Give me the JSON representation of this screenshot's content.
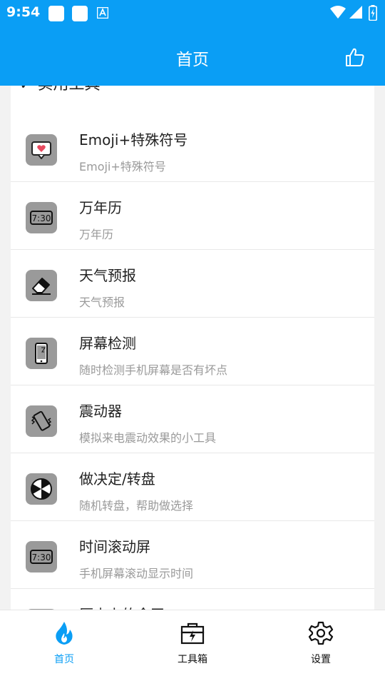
{
  "status_bar": {
    "time": "9:54"
  },
  "app_bar": {
    "title": "首页"
  },
  "section": {
    "title": "实用工具"
  },
  "tools": [
    {
      "title": "Emoji+特殊符号",
      "subtitle": "Emoji+特殊符号",
      "icon": "emoji-heart-icon"
    },
    {
      "title": "万年历",
      "subtitle": "万年历",
      "icon": "calendar-clock-icon"
    },
    {
      "title": "天气预报",
      "subtitle": "天气预报",
      "icon": "eraser-icon"
    },
    {
      "title": "屏幕检测",
      "subtitle": "随时检测手机屏幕是否有坏点",
      "icon": "phone-screen-icon"
    },
    {
      "title": "震动器",
      "subtitle": "模拟来电震动效果的小工具",
      "icon": "vibrate-icon"
    },
    {
      "title": "做决定/转盘",
      "subtitle": "随机转盘，帮助做选择",
      "icon": "wheel-icon"
    },
    {
      "title": "时间滚动屏",
      "subtitle": "手机屏幕滚动显示时间",
      "icon": "clock-display-icon"
    },
    {
      "title": "历史上的今天",
      "subtitle": "",
      "icon": "history-icon"
    }
  ],
  "bottom_nav": {
    "home": "首页",
    "toolbox": "工具箱",
    "settings": "设置",
    "active_color": "#0a9ef5"
  },
  "colors": {
    "primary": "#0a9ef5",
    "icon_bg": "#9a9a9a"
  }
}
